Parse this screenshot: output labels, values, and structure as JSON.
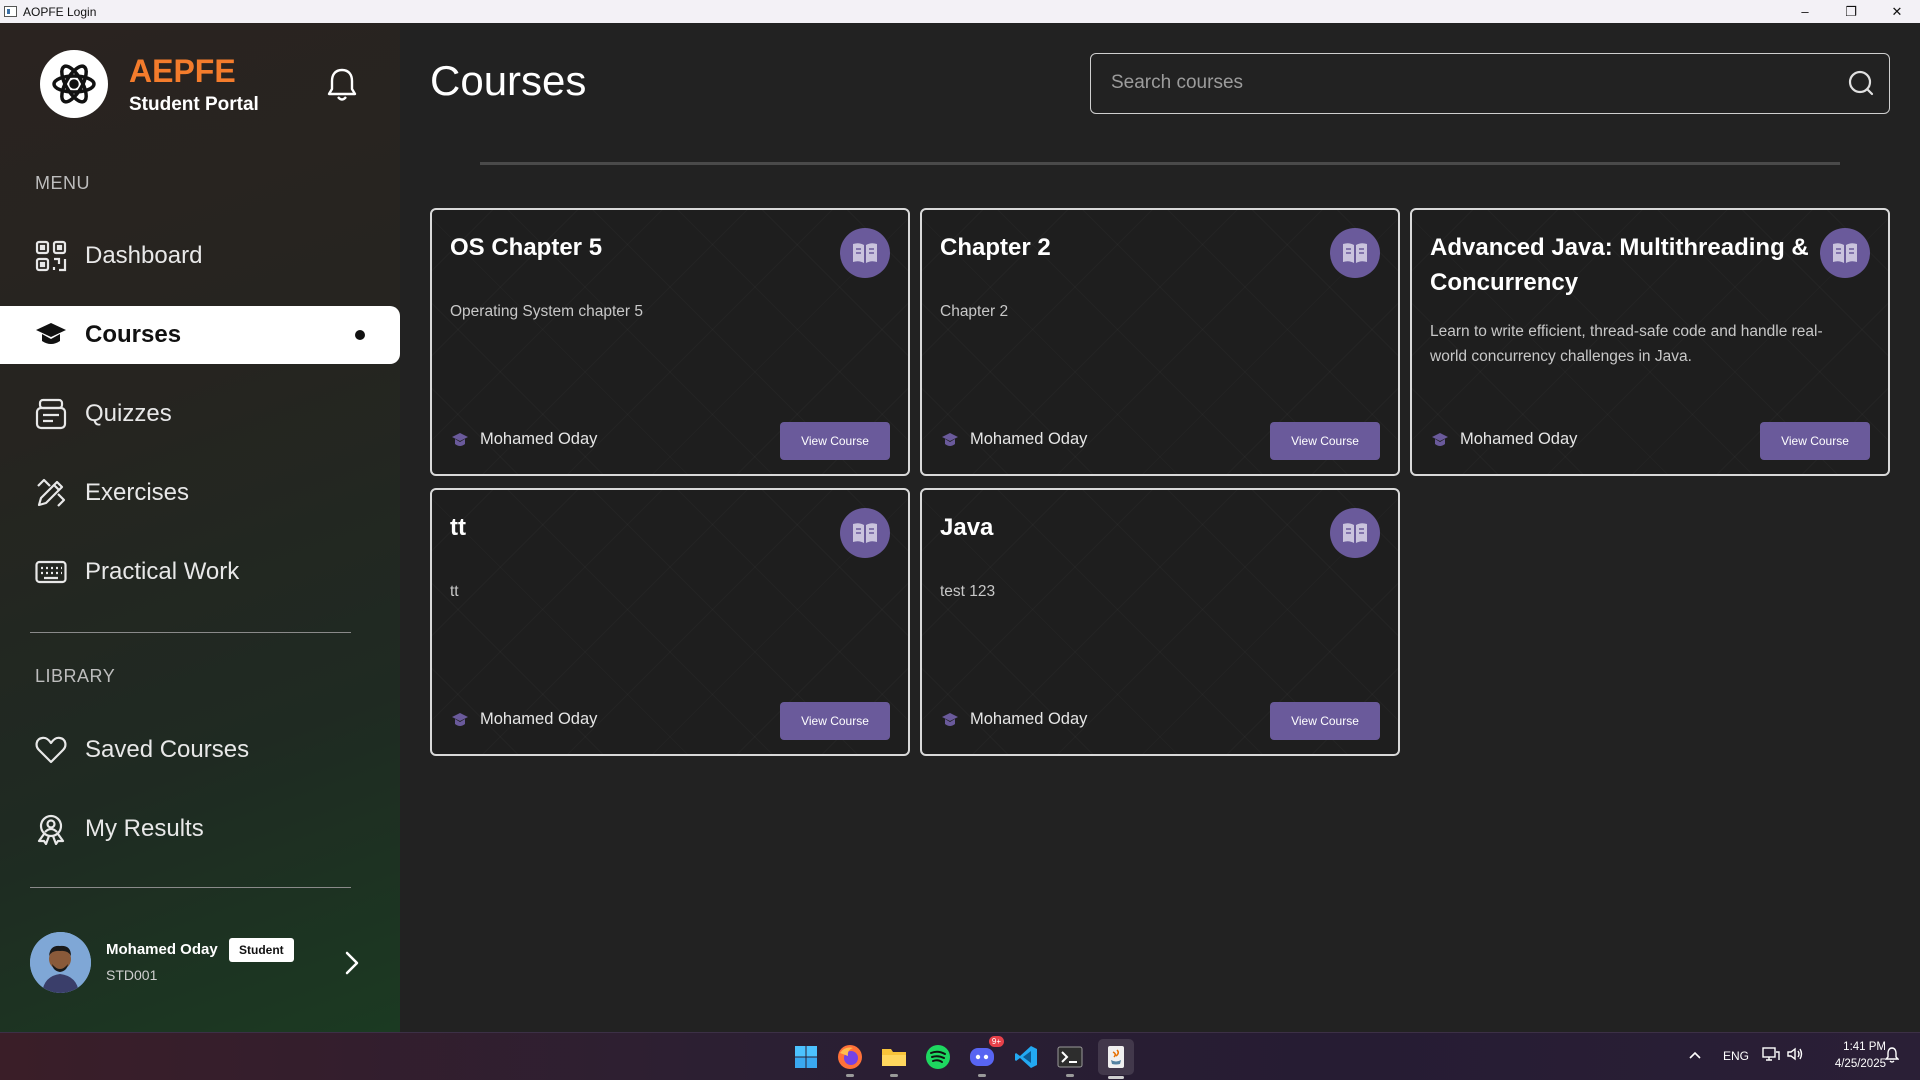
{
  "window": {
    "title": "AOPFE Login",
    "minimize": "–",
    "maximize": "❐",
    "close": "✕"
  },
  "brand": {
    "name": "AEPFE",
    "subtitle": "Student Portal"
  },
  "sidebar": {
    "menu_label": "MENU",
    "library_label": "LIBRARY",
    "menu_items": [
      {
        "label": "Dashboard",
        "icon": "qr-grid-icon"
      },
      {
        "label": "Courses",
        "icon": "graduation-cap-icon",
        "active": true
      },
      {
        "label": "Quizzes",
        "icon": "quiz-icon"
      },
      {
        "label": "Exercises",
        "icon": "pencil-ruler-icon"
      },
      {
        "label": "Practical Work",
        "icon": "keyboard-icon"
      }
    ],
    "library_items": [
      {
        "label": "Saved Courses",
        "icon": "heart-icon"
      },
      {
        "label": "My Results",
        "icon": "award-icon"
      }
    ]
  },
  "user": {
    "name": "Mohamed Oday",
    "role": "Student",
    "id": "STD001"
  },
  "main": {
    "title": "Courses",
    "search_placeholder": "Search courses",
    "courses": [
      {
        "title": "OS Chapter 5",
        "description": "Operating System chapter 5",
        "author": "Mohamed Oday",
        "button": "View Course"
      },
      {
        "title": "Chapter 2",
        "description": "Chapter 2",
        "author": "Mohamed Oday",
        "button": "View Course"
      },
      {
        "title": "Advanced Java: Multithreading & Concurrency",
        "description": "Learn to write efficient, thread-safe code and handle real-world concurrency challenges in Java.",
        "author": "Mohamed Oday",
        "button": "View Course"
      },
      {
        "title": "tt",
        "description": "tt",
        "author": "Mohamed Oday",
        "button": "View Course"
      },
      {
        "title": "Java",
        "description": "test 123",
        "author": "Mohamed Oday",
        "button": "View Course"
      }
    ]
  },
  "taskbar": {
    "apps": [
      "windows-start-icon",
      "firefox-icon",
      "file-explorer-icon",
      "spotify-icon",
      "discord-icon",
      "vscode-icon",
      "terminal-icon",
      "java-app-icon"
    ],
    "discord_badge": "9+",
    "language": "ENG",
    "time": "1:41 PM",
    "date": "4/25/2025"
  },
  "colors": {
    "accent": "#f47c2c",
    "button": "#6a5a9b",
    "background": "#222222"
  }
}
